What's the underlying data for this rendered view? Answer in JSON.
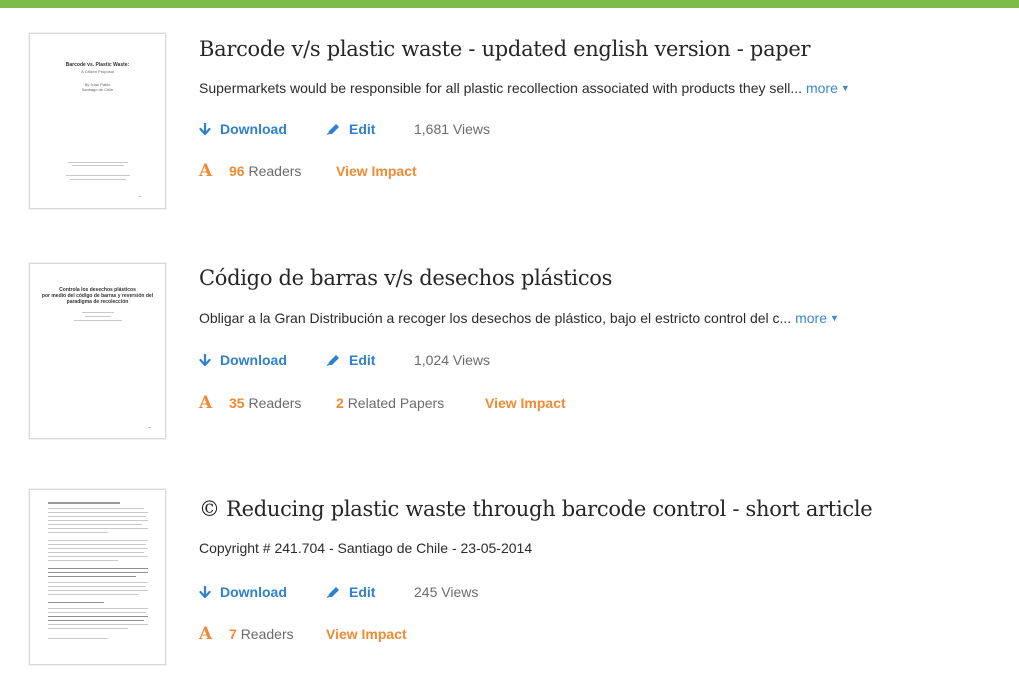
{
  "colors": {
    "accent_green": "#7cbd4a",
    "link_blue": "#2f80cf",
    "impact_orange": "#f08a34"
  },
  "papers": [
    {
      "title": "Barcode v/s plastic waste - updated english version - paper",
      "summary": "Supermarkets would be responsible for all plastic recollection associated with products they sell...",
      "more_label": "more",
      "download_label": "Download",
      "edit_label": "Edit",
      "views": "1,681 Views",
      "readers_count": "96",
      "readers_label": "Readers",
      "view_impact_label": "View Impact",
      "thumbnail": {
        "heading": "Barcode vs. Plastic Waste:",
        "subheading": "A Citizen Proposal",
        "author": "By Juan Pablo",
        "author2": "Santiago de Chile"
      }
    },
    {
      "title": "Código de barras v/s desechos plásticos",
      "summary": "Obligar a la Gran Distribución a recoger los desechos de plástico, bajo el estricto control del c...",
      "more_label": "more",
      "download_label": "Download",
      "edit_label": "Edit",
      "views": "1,024 Views",
      "readers_count": "35",
      "readers_label": "Readers",
      "related_count": "2",
      "related_label": "Related Papers",
      "view_impact_label": "View Impact",
      "thumbnail": {
        "heading": "Controla los desechos plásticos",
        "heading2": "por medio del código de barras y reversión del",
        "heading3": "paradigma de recolección"
      }
    },
    {
      "title": "© Reducing plastic waste through barcode control - short article",
      "summary": "Copyright # 241.704 - Santiago de Chile - 23-05-2014",
      "download_label": "Download",
      "edit_label": "Edit",
      "views": "245 Views",
      "readers_count": "7",
      "readers_label": "Readers",
      "view_impact_label": "View Impact"
    }
  ]
}
